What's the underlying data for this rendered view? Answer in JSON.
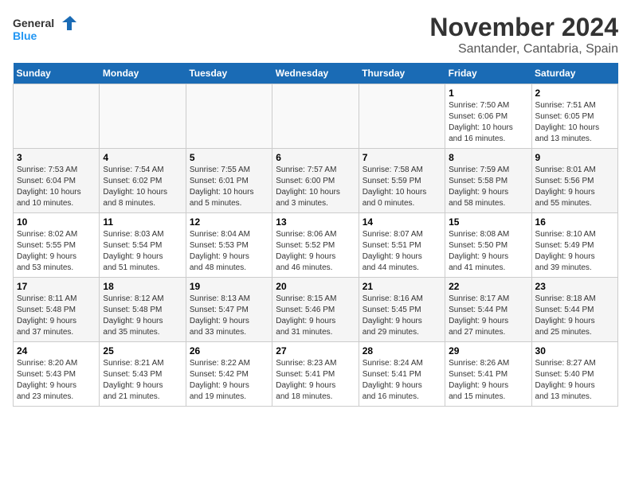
{
  "logo": {
    "line1": "General",
    "line2": "Blue"
  },
  "title": "November 2024",
  "subtitle": "Santander, Cantabria, Spain",
  "weekdays": [
    "Sunday",
    "Monday",
    "Tuesday",
    "Wednesday",
    "Thursday",
    "Friday",
    "Saturday"
  ],
  "weeks": [
    [
      {
        "day": "",
        "info": ""
      },
      {
        "day": "",
        "info": ""
      },
      {
        "day": "",
        "info": ""
      },
      {
        "day": "",
        "info": ""
      },
      {
        "day": "",
        "info": ""
      },
      {
        "day": "1",
        "info": "Sunrise: 7:50 AM\nSunset: 6:06 PM\nDaylight: 10 hours\nand 16 minutes."
      },
      {
        "day": "2",
        "info": "Sunrise: 7:51 AM\nSunset: 6:05 PM\nDaylight: 10 hours\nand 13 minutes."
      }
    ],
    [
      {
        "day": "3",
        "info": "Sunrise: 7:53 AM\nSunset: 6:04 PM\nDaylight: 10 hours\nand 10 minutes."
      },
      {
        "day": "4",
        "info": "Sunrise: 7:54 AM\nSunset: 6:02 PM\nDaylight: 10 hours\nand 8 minutes."
      },
      {
        "day": "5",
        "info": "Sunrise: 7:55 AM\nSunset: 6:01 PM\nDaylight: 10 hours\nand 5 minutes."
      },
      {
        "day": "6",
        "info": "Sunrise: 7:57 AM\nSunset: 6:00 PM\nDaylight: 10 hours\nand 3 minutes."
      },
      {
        "day": "7",
        "info": "Sunrise: 7:58 AM\nSunset: 5:59 PM\nDaylight: 10 hours\nand 0 minutes."
      },
      {
        "day": "8",
        "info": "Sunrise: 7:59 AM\nSunset: 5:58 PM\nDaylight: 9 hours\nand 58 minutes."
      },
      {
        "day": "9",
        "info": "Sunrise: 8:01 AM\nSunset: 5:56 PM\nDaylight: 9 hours\nand 55 minutes."
      }
    ],
    [
      {
        "day": "10",
        "info": "Sunrise: 8:02 AM\nSunset: 5:55 PM\nDaylight: 9 hours\nand 53 minutes."
      },
      {
        "day": "11",
        "info": "Sunrise: 8:03 AM\nSunset: 5:54 PM\nDaylight: 9 hours\nand 51 minutes."
      },
      {
        "day": "12",
        "info": "Sunrise: 8:04 AM\nSunset: 5:53 PM\nDaylight: 9 hours\nand 48 minutes."
      },
      {
        "day": "13",
        "info": "Sunrise: 8:06 AM\nSunset: 5:52 PM\nDaylight: 9 hours\nand 46 minutes."
      },
      {
        "day": "14",
        "info": "Sunrise: 8:07 AM\nSunset: 5:51 PM\nDaylight: 9 hours\nand 44 minutes."
      },
      {
        "day": "15",
        "info": "Sunrise: 8:08 AM\nSunset: 5:50 PM\nDaylight: 9 hours\nand 41 minutes."
      },
      {
        "day": "16",
        "info": "Sunrise: 8:10 AM\nSunset: 5:49 PM\nDaylight: 9 hours\nand 39 minutes."
      }
    ],
    [
      {
        "day": "17",
        "info": "Sunrise: 8:11 AM\nSunset: 5:48 PM\nDaylight: 9 hours\nand 37 minutes."
      },
      {
        "day": "18",
        "info": "Sunrise: 8:12 AM\nSunset: 5:48 PM\nDaylight: 9 hours\nand 35 minutes."
      },
      {
        "day": "19",
        "info": "Sunrise: 8:13 AM\nSunset: 5:47 PM\nDaylight: 9 hours\nand 33 minutes."
      },
      {
        "day": "20",
        "info": "Sunrise: 8:15 AM\nSunset: 5:46 PM\nDaylight: 9 hours\nand 31 minutes."
      },
      {
        "day": "21",
        "info": "Sunrise: 8:16 AM\nSunset: 5:45 PM\nDaylight: 9 hours\nand 29 minutes."
      },
      {
        "day": "22",
        "info": "Sunrise: 8:17 AM\nSunset: 5:44 PM\nDaylight: 9 hours\nand 27 minutes."
      },
      {
        "day": "23",
        "info": "Sunrise: 8:18 AM\nSunset: 5:44 PM\nDaylight: 9 hours\nand 25 minutes."
      }
    ],
    [
      {
        "day": "24",
        "info": "Sunrise: 8:20 AM\nSunset: 5:43 PM\nDaylight: 9 hours\nand 23 minutes."
      },
      {
        "day": "25",
        "info": "Sunrise: 8:21 AM\nSunset: 5:43 PM\nDaylight: 9 hours\nand 21 minutes."
      },
      {
        "day": "26",
        "info": "Sunrise: 8:22 AM\nSunset: 5:42 PM\nDaylight: 9 hours\nand 19 minutes."
      },
      {
        "day": "27",
        "info": "Sunrise: 8:23 AM\nSunset: 5:41 PM\nDaylight: 9 hours\nand 18 minutes."
      },
      {
        "day": "28",
        "info": "Sunrise: 8:24 AM\nSunset: 5:41 PM\nDaylight: 9 hours\nand 16 minutes."
      },
      {
        "day": "29",
        "info": "Sunrise: 8:26 AM\nSunset: 5:41 PM\nDaylight: 9 hours\nand 15 minutes."
      },
      {
        "day": "30",
        "info": "Sunrise: 8:27 AM\nSunset: 5:40 PM\nDaylight: 9 hours\nand 13 minutes."
      }
    ]
  ]
}
